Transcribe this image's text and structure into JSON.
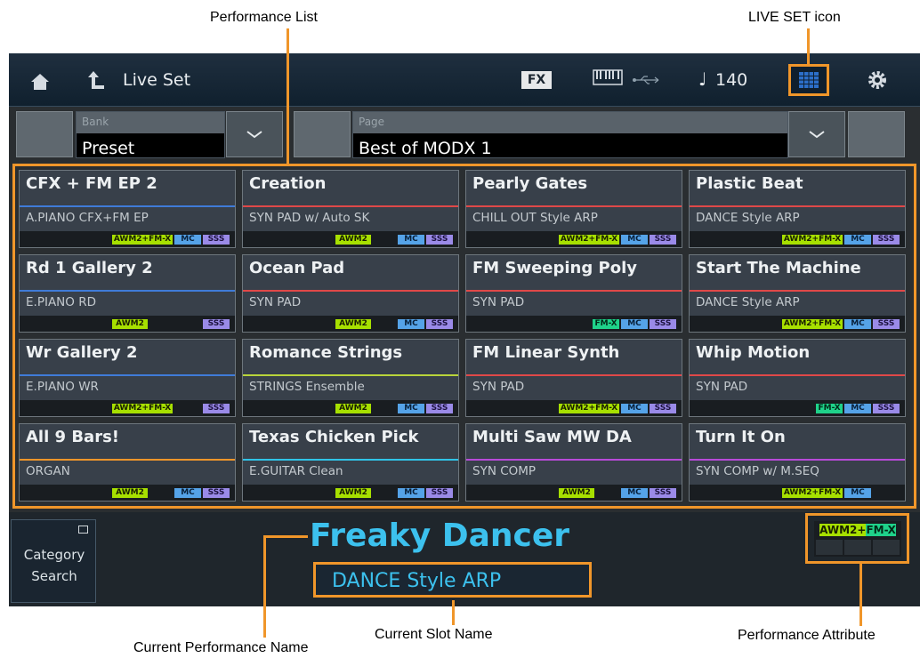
{
  "annotations": {
    "performance_list": "Performance List",
    "liveset_icon": "LIVE SET icon",
    "current_performance_name": "Current Performance Name",
    "current_slot_name": "Current Slot Name",
    "performance_attribute": "Performance Attribute"
  },
  "topbar": {
    "title": "Live Set",
    "fx": "FX",
    "tempo": "140"
  },
  "bank": {
    "label": "Bank",
    "value": "Preset"
  },
  "page": {
    "label": "Page",
    "value": "Best of MODX 1"
  },
  "slots": [
    {
      "name": "CFX + FM EP 2",
      "sub": "A.PIANO CFX+FM EP",
      "color": "#3f7bd8",
      "attrs": [
        "awmfm",
        "mc",
        "ssc"
      ]
    },
    {
      "name": "Creation",
      "sub": "SYN PAD w/ Auto SK",
      "color": "#e04848",
      "attrs": [
        "awm",
        "mc",
        "ssc"
      ]
    },
    {
      "name": "Pearly Gates",
      "sub": "CHILL OUT Style ARP",
      "color": "#e04848",
      "attrs": [
        "awmfm",
        "mc",
        "ssc"
      ]
    },
    {
      "name": "Plastic Beat",
      "sub": "DANCE Style ARP",
      "color": "#e04848",
      "attrs": [
        "awmfm",
        "mc",
        "ssc"
      ]
    },
    {
      "name": "Rd 1 Gallery 2",
      "sub": "E.PIANO RD",
      "color": "#3f7bd8",
      "attrs": [
        "awm",
        "ssc"
      ]
    },
    {
      "name": "Ocean Pad",
      "sub": "SYN PAD",
      "color": "#e04848",
      "attrs": [
        "awm",
        "mc",
        "ssc"
      ]
    },
    {
      "name": "FM Sweeping Poly",
      "sub": "SYN PAD",
      "color": "#e04848",
      "attrs": [
        "fmx",
        "mc",
        "ssc"
      ]
    },
    {
      "name": "Start The Machine",
      "sub": "DANCE Style ARP",
      "color": "#e04848",
      "attrs": [
        "awmfm",
        "mc",
        "ssc"
      ]
    },
    {
      "name": "Wr Gallery 2",
      "sub": "E.PIANO WR",
      "color": "#3f7bd8",
      "attrs": [
        "awmfm",
        "ssc"
      ]
    },
    {
      "name": "Romance Strings",
      "sub": "STRINGS Ensemble",
      "color": "#b9d43a",
      "attrs": [
        "awm",
        "mc",
        "ssc"
      ]
    },
    {
      "name": "FM Linear Synth",
      "sub": "SYN PAD",
      "color": "#e04848",
      "attrs": [
        "awmfm",
        "mc",
        "ssc"
      ]
    },
    {
      "name": "Whip Motion",
      "sub": "SYN PAD",
      "color": "#e04848",
      "attrs": [
        "fmx",
        "mc",
        "ssc"
      ]
    },
    {
      "name": "All 9 Bars!",
      "sub": "ORGAN",
      "color": "#f0962a",
      "attrs": [
        "awm",
        "mc",
        "ssc"
      ]
    },
    {
      "name": "Texas Chicken Pick",
      "sub": "E.GUITAR Clean",
      "color": "#30c4e8",
      "attrs": [
        "awm",
        "mc",
        "ssc"
      ]
    },
    {
      "name": "Multi Saw MW DA",
      "sub": "SYN COMP",
      "color": "#b84ad8",
      "attrs": [
        "awm",
        "mc",
        "ssc"
      ]
    },
    {
      "name": "Turn It On",
      "sub": "SYN COMP w/ M.SEQ",
      "color": "#b84ad8",
      "attrs": [
        "awmfm",
        "mc"
      ]
    }
  ],
  "attr_labels": {
    "awm": "AWM2",
    "awmfm": "AWM2+FM-X",
    "fmx": "FM-X",
    "mc": "MC",
    "ssc": "SSS"
  },
  "category_search": {
    "line1": "Category",
    "line2": "Search"
  },
  "current": {
    "performance_name": "Freaky Dancer",
    "slot_name": "DANCE Style ARP",
    "attr_awm": "AWM2+",
    "attr_fmx": "FM-X"
  },
  "colors": {
    "accent_orange": "#f0962a",
    "title_blue": "#3cc1ee"
  }
}
